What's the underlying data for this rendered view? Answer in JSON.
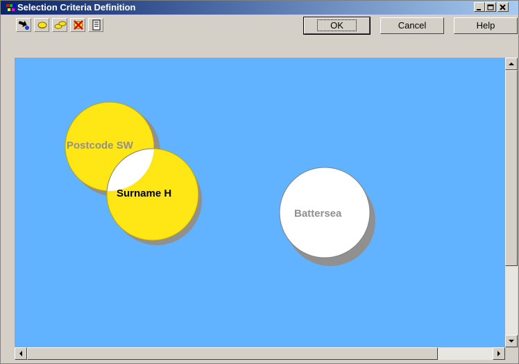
{
  "window": {
    "title": "Selection Criteria Definition"
  },
  "buttons": {
    "ok": "OK",
    "cancel": "Cancel",
    "help": "Help"
  },
  "toolbar": {
    "tools": [
      "add-criteria-icon",
      "circle-icon",
      "link-circles-icon",
      "delete-icon",
      "list-icon"
    ]
  },
  "colors": {
    "canvas": "#61b2ff",
    "selected_circle": "#ffe614",
    "unselected_circle": "#ffffff",
    "shadow": "#909090"
  },
  "canvas": {
    "circles": [
      {
        "label": "Postcode SW",
        "fill": "#ffe614"
      },
      {
        "label": "Surname H",
        "fill": "#ffe614"
      },
      {
        "label": "Battersea",
        "fill": "#ffffff"
      }
    ]
  }
}
